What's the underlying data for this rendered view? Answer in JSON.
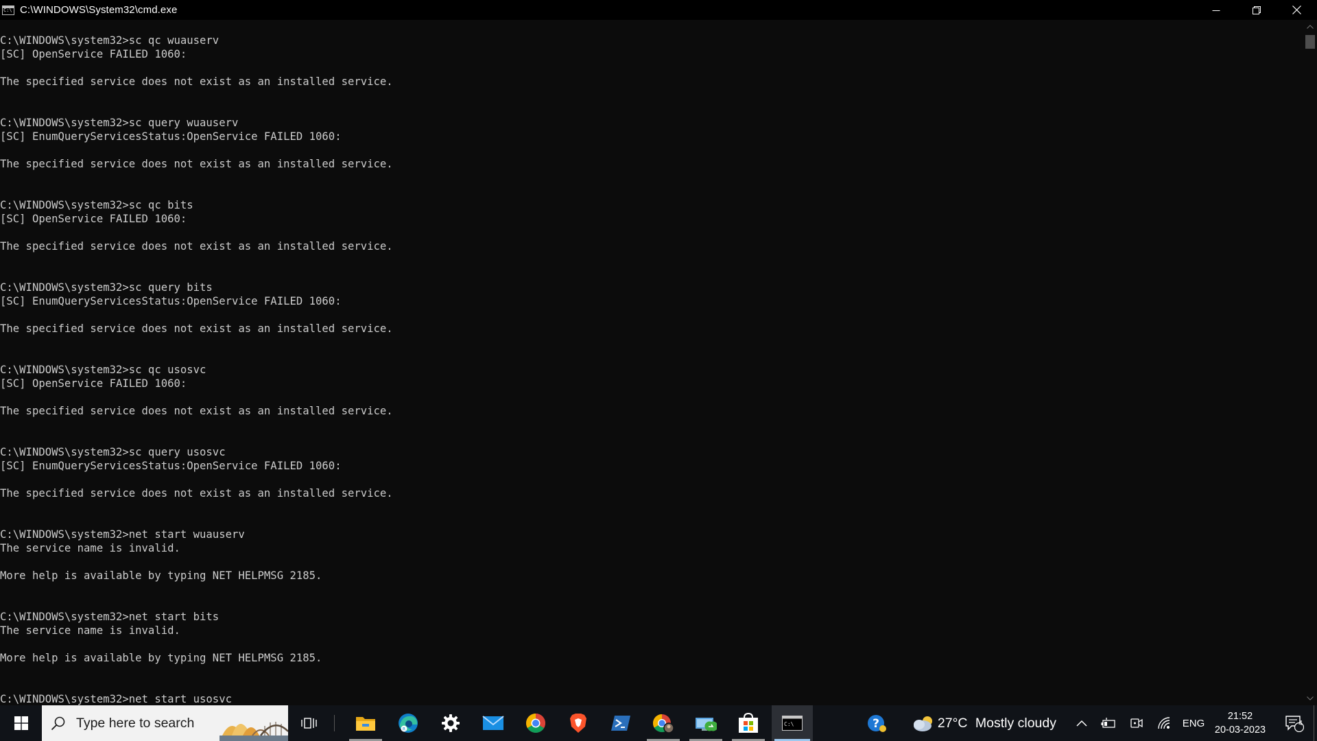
{
  "window": {
    "title": "C:\\WINDOWS\\System32\\cmd.exe",
    "icon": "cmd-icon"
  },
  "console": {
    "lines": [
      "C:\\WINDOWS\\system32>sc qc wuauserv",
      "[SC] OpenService FAILED 1060:",
      "",
      "The specified service does not exist as an installed service.",
      "",
      "",
      "C:\\WINDOWS\\system32>sc query wuauserv",
      "[SC] EnumQueryServicesStatus:OpenService FAILED 1060:",
      "",
      "The specified service does not exist as an installed service.",
      "",
      "",
      "C:\\WINDOWS\\system32>sc qc bits",
      "[SC] OpenService FAILED 1060:",
      "",
      "The specified service does not exist as an installed service.",
      "",
      "",
      "C:\\WINDOWS\\system32>sc query bits",
      "[SC] EnumQueryServicesStatus:OpenService FAILED 1060:",
      "",
      "The specified service does not exist as an installed service.",
      "",
      "",
      "C:\\WINDOWS\\system32>sc qc usosvc",
      "[SC] OpenService FAILED 1060:",
      "",
      "The specified service does not exist as an installed service.",
      "",
      "",
      "C:\\WINDOWS\\system32>sc query usosvc",
      "[SC] EnumQueryServicesStatus:OpenService FAILED 1060:",
      "",
      "The specified service does not exist as an installed service.",
      "",
      "",
      "C:\\WINDOWS\\system32>net start wuauserv",
      "The service name is invalid.",
      "",
      "More help is available by typing NET HELPMSG 2185.",
      "",
      "",
      "C:\\WINDOWS\\system32>net start bits",
      "The service name is invalid.",
      "",
      "More help is available by typing NET HELPMSG 2185.",
      "",
      "",
      "C:\\WINDOWS\\system32>net start usosvc"
    ]
  },
  "taskbar": {
    "search_placeholder": "Type here to search",
    "apps": [
      {
        "name": "file-explorer",
        "icon": "folder-icon"
      },
      {
        "name": "edge",
        "icon": "edge-icon"
      },
      {
        "name": "settings",
        "icon": "gear-icon"
      },
      {
        "name": "mail",
        "icon": "mail-icon"
      },
      {
        "name": "chrome",
        "icon": "chrome-icon"
      },
      {
        "name": "brave",
        "icon": "brave-icon"
      },
      {
        "name": "powershell",
        "icon": "powershell-icon"
      },
      {
        "name": "chrome-profile",
        "icon": "chrome-profile-icon"
      },
      {
        "name": "remote-desktop",
        "icon": "remote-desktop-icon"
      },
      {
        "name": "microsoft-store",
        "icon": "store-icon"
      },
      {
        "name": "command-prompt",
        "icon": "cmd-icon"
      }
    ],
    "weather": {
      "temperature": "27°C",
      "condition": "Mostly cloudy"
    },
    "language": "ENG",
    "clock": {
      "time": "21:52",
      "date": "20-03-2023"
    },
    "notification_count": "4",
    "colors": {
      "taskbar_bg": "#101318",
      "console_bg": "#0c0c0c",
      "console_fg": "#cccccc",
      "active_indicator": "#9ec9f0"
    }
  }
}
